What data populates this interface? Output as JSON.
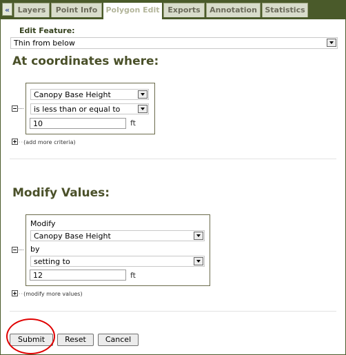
{
  "tabs": {
    "collapse": "«",
    "items": [
      "Layers",
      "Point Info",
      "Polygon Edit",
      "Exports",
      "Annotation",
      "Statistics"
    ],
    "active": "Polygon Edit"
  },
  "feature": {
    "label": "Edit Feature:",
    "selected": "Thin from below"
  },
  "criteria": {
    "heading": "At coordinates where:",
    "field": "Canopy Base Height",
    "operator": "is less than or equal to",
    "value": "10",
    "unit": "ft",
    "add_more": "(add more criteria)"
  },
  "modify": {
    "heading": "Modify Values:",
    "label": "Modify",
    "field": "Canopy Base Height",
    "by_label": "by",
    "method": "setting to",
    "value": "12",
    "unit": "ft",
    "add_more": "(modify more values)"
  },
  "buttons": {
    "submit": "Submit",
    "reset": "Reset",
    "cancel": "Cancel"
  },
  "colors": {
    "header_bg": "#4a5a2a",
    "heading_text": "#4a5029",
    "highlight_circle": "#e00000"
  }
}
